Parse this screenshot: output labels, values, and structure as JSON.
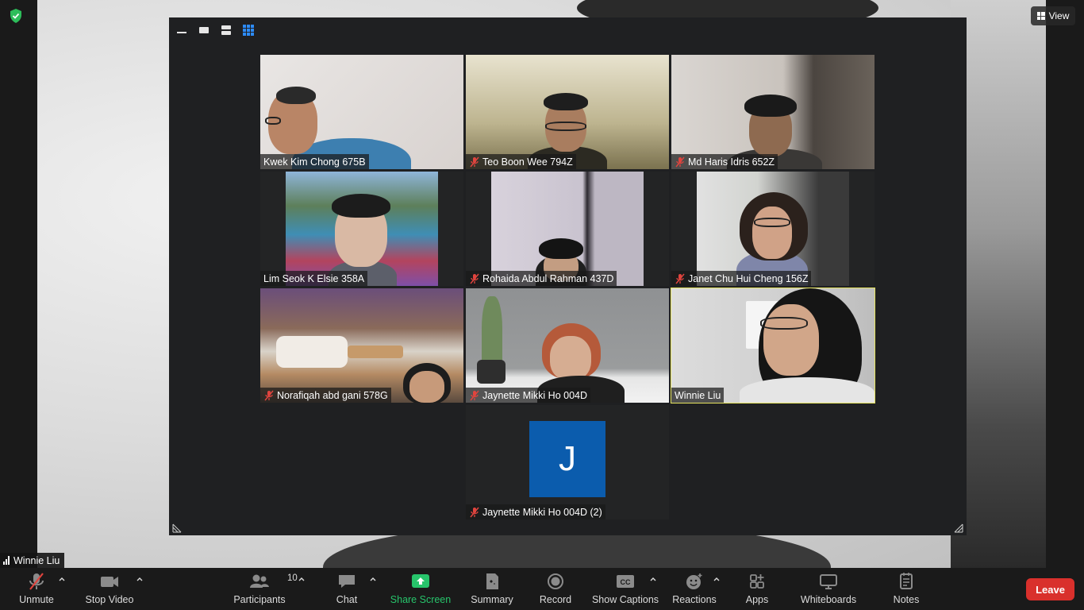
{
  "view": {
    "label": "View"
  },
  "layout_options": [
    "speaker-view",
    "thumbnail-strip",
    "top-strip",
    "gallery-view"
  ],
  "participants": [
    {
      "name": "Kwek Kim Chong 675B",
      "muted": false
    },
    {
      "name": "Teo Boon Wee 794Z",
      "muted": true
    },
    {
      "name": "Md Haris Idris 652Z",
      "muted": true
    },
    {
      "name": "Lim Seok K Elsie 358A",
      "muted": false
    },
    {
      "name": "Rohaida Abdul Rahman 437D",
      "muted": true
    },
    {
      "name": "Janet Chu Hui Cheng 156Z",
      "muted": true
    },
    {
      "name": "Norafiqah abd gani 578G",
      "muted": true
    },
    {
      "name": "Jaynette Mikki Ho 004D",
      "muted": true
    },
    {
      "name": "Winnie Liu",
      "muted": false,
      "active_speaker": true
    },
    {
      "name": "Jaynette Mikki Ho 004D (2)",
      "muted": true,
      "avatar_letter": "J"
    }
  ],
  "self": {
    "name": "Winnie Liu"
  },
  "toolbar": {
    "unmute": "Unmute",
    "stop_video": "Stop Video",
    "participants": "Participants",
    "participants_count": "10",
    "chat": "Chat",
    "share_screen": "Share Screen",
    "summary": "Summary",
    "record": "Record",
    "show_captions": "Show Captions",
    "reactions": "Reactions",
    "apps": "Apps",
    "whiteboards": "Whiteboards",
    "notes": "Notes",
    "leave": "Leave"
  },
  "colors": {
    "active_speaker_border": "#e4e25e",
    "share_screen_green": "#27c46b",
    "leave_red": "#d9302c",
    "avatar_blue": "#0b5cad",
    "mute_red": "#e0443e",
    "shield_green": "#2dbd5a"
  },
  "icons": [
    "shield-icon",
    "mic-off-icon",
    "camera-icon",
    "participants-icon",
    "chat-icon",
    "share-screen-icon",
    "summary-icon",
    "record-icon",
    "captions-icon",
    "reactions-icon",
    "apps-icon",
    "whiteboard-icon",
    "notes-icon",
    "signal-icon",
    "grid-icon",
    "resize-icon"
  ]
}
